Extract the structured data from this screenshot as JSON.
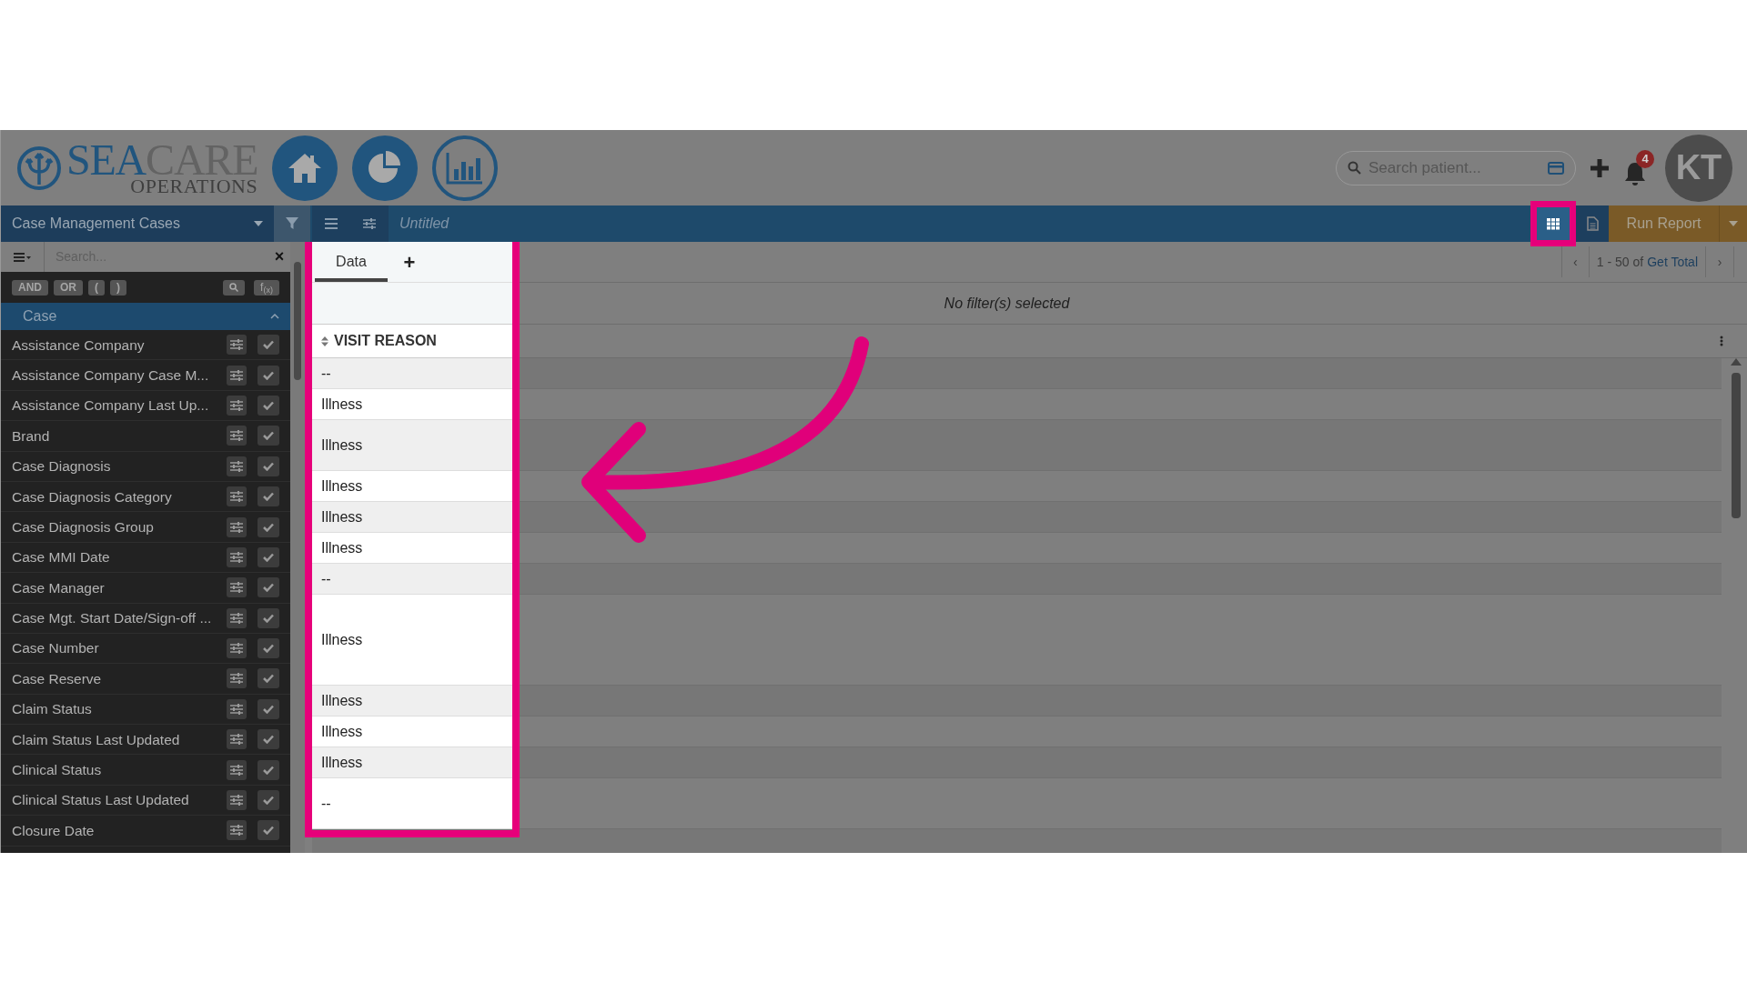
{
  "logo": {
    "part1": "SEA",
    "part2": "CARE",
    "subtitle": "OPERATIONS"
  },
  "nav_buttons": [
    {
      "kind": "home",
      "selected": false
    },
    {
      "kind": "pie",
      "selected": false
    },
    {
      "kind": "bar",
      "selected": true
    }
  ],
  "patient_search": {
    "placeholder": "Search patient..."
  },
  "notifications": {
    "badge": "4"
  },
  "avatar": {
    "initials": "KT"
  },
  "toolbar": {
    "dataset": "Case Management Cases",
    "report_title": "Untitled",
    "view_buttons": [
      {
        "kind": "grid",
        "selected": true
      },
      {
        "kind": "document",
        "selected": false
      }
    ],
    "run_button": "Run Report"
  },
  "sidebar": {
    "search": {
      "placeholder": "Search..."
    },
    "clear": "×",
    "operators": [
      "AND",
      "OR",
      "(",
      ")"
    ],
    "function_button": "f$_{(x)}$",
    "group": {
      "label": "Case",
      "expanded": true
    },
    "items": [
      "Assistance Company",
      "Assistance Company Case M...",
      "Assistance Company Last Up...",
      "Brand",
      "Case Diagnosis",
      "Case Diagnosis Category",
      "Case Diagnosis Group",
      "Case MMI Date",
      "Case Manager",
      "Case Mgt. Start Date/Sign-off ...",
      "Case Number",
      "Case Reserve",
      "Claim Status",
      "Claim Status Last Updated",
      "Clinical Status",
      "Clinical Status Last Updated",
      "Closure Date"
    ]
  },
  "tabs": [
    {
      "label": "Data",
      "selected": true
    },
    {
      "label": "+",
      "selected": false
    }
  ],
  "pagination": {
    "prev": "‹",
    "range": "1 - 50",
    "of": "of",
    "total_link": "Get Total",
    "next": "›"
  },
  "filter_status": "No filter(s) selected",
  "table": {
    "column": "VISIT REASON",
    "rows": [
      {
        "value": "--"
      },
      {
        "value": "Illness"
      },
      {
        "value": "Illness"
      },
      {
        "value": "Illness"
      },
      {
        "value": "Illness"
      },
      {
        "value": "Illness"
      },
      {
        "value": "--"
      },
      {
        "value": "Illness"
      },
      {
        "value": "Illness"
      },
      {
        "value": "Illness"
      },
      {
        "value": "Illness"
      },
      {
        "value": "--"
      }
    ]
  }
}
